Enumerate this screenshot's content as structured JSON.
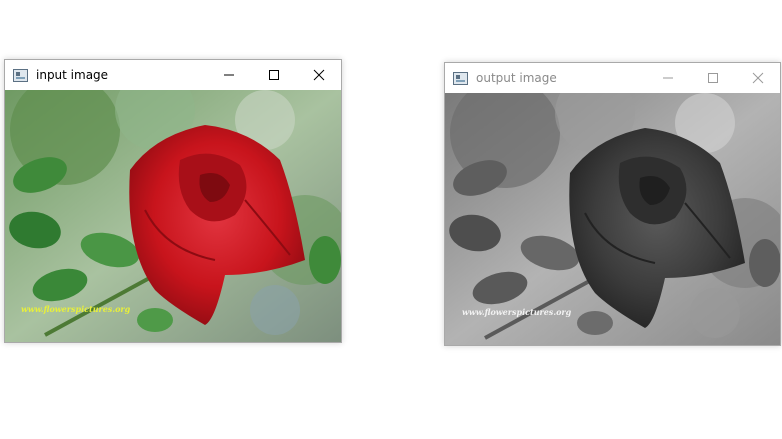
{
  "windows": [
    {
      "title": "input image",
      "active": true,
      "image": {
        "subject": "red rose with green leaves",
        "watermark": "www.flowerspictures.org"
      }
    },
    {
      "title": "output image",
      "active": false,
      "image": {
        "subject": "grayscale rose with leaves",
        "watermark": "www.flowerspictures.org"
      }
    }
  ],
  "icons": {
    "app": "app-image-icon",
    "minimize": "minimize-icon",
    "maximize": "maximize-icon",
    "close": "close-icon"
  },
  "colors": {
    "rose": "#c8141c",
    "leaf": "#3f8a3a",
    "watermark_input": "#e8f03a",
    "watermark_output": "#f2f2f2"
  }
}
